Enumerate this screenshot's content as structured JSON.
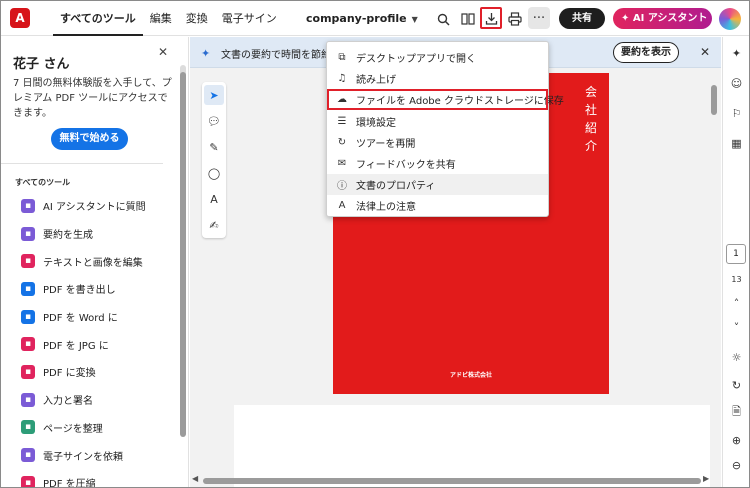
{
  "topbar": {
    "logo_glyph": "A",
    "tabs": [
      "すべてのツール",
      "編集",
      "変換",
      "電子サイン"
    ],
    "active_tab": 0,
    "doc_title": "company-profile",
    "share_label": "共有",
    "ai_label": "AI アシスタント"
  },
  "left_panel": {
    "user_name": "花子 さん",
    "description": "7 日間の無料体験版を入手して、プレミアム PDF ツールにアクセスできます。",
    "trial_button": "無料で始める",
    "section_title": "すべてのツール",
    "tools": [
      {
        "label": "AI アシスタントに質問",
        "icon": "ai-assistant-icon",
        "color": "#7b5bd6"
      },
      {
        "label": "要約を生成",
        "icon": "summary-icon",
        "color": "#7b5bd6"
      },
      {
        "label": "テキストと画像を編集",
        "icon": "edit-text-image-icon",
        "color": "#e0245e"
      },
      {
        "label": "PDF を書き出し",
        "icon": "export-pdf-icon",
        "color": "#1473e6"
      },
      {
        "label": "PDF を Word に",
        "icon": "pdf-to-word-icon",
        "color": "#1473e6"
      },
      {
        "label": "PDF を JPG に",
        "icon": "pdf-to-jpg-icon",
        "color": "#e0245e"
      },
      {
        "label": "PDF に変換",
        "icon": "convert-pdf-icon",
        "color": "#e0245e"
      },
      {
        "label": "入力と署名",
        "icon": "fill-sign-icon",
        "color": "#7b5bd6"
      },
      {
        "label": "ページを整理",
        "icon": "organize-pages-icon",
        "color": "#2d9d78"
      },
      {
        "label": "電子サインを依頼",
        "icon": "request-signature-icon",
        "color": "#7b5bd6"
      },
      {
        "label": "PDF を圧縮",
        "icon": "compress-pdf-icon",
        "color": "#e0245e"
      }
    ]
  },
  "banner": {
    "text": "文書の要約で時間を節約",
    "button": "要約を表示"
  },
  "document": {
    "cover_title": "会社紹介",
    "cover_title_chars": [
      "会",
      "社",
      "紹",
      "介"
    ],
    "footer": "アドビ株式会社",
    "cover_color": "#e21b1b"
  },
  "menu": {
    "items": [
      {
        "label": "デスクトップアプリで開く",
        "icon": "external-open-icon",
        "glyph": "⧉"
      },
      {
        "label": "読み上げ",
        "icon": "headphones-icon",
        "glyph": "♫"
      },
      {
        "label": "ファイルを Adobe クラウドストレージに保存",
        "icon": "cloud-upload-icon",
        "glyph": "☁",
        "highlighted": true
      },
      {
        "label": "環境設定",
        "icon": "preferences-icon",
        "glyph": "☰"
      },
      {
        "label": "ツアーを再開",
        "icon": "tour-icon",
        "glyph": "↻"
      },
      {
        "label": "フィードバックを共有",
        "icon": "feedback-icon",
        "glyph": "✉"
      },
      {
        "label": "文書のプロパティ",
        "icon": "document-properties-icon",
        "glyph": "ⓘ",
        "hovered": true
      },
      {
        "label": "法律上の注意",
        "icon": "adobe-legal-icon",
        "glyph": "A"
      }
    ]
  },
  "right_rail": {
    "current_page": "1",
    "total_pages": "13"
  },
  "colors": {
    "accent": "#1473e6",
    "highlight": "#e0202a",
    "ai_gradient_start": "#e0245e",
    "ai_gradient_end": "#b01c8f"
  }
}
